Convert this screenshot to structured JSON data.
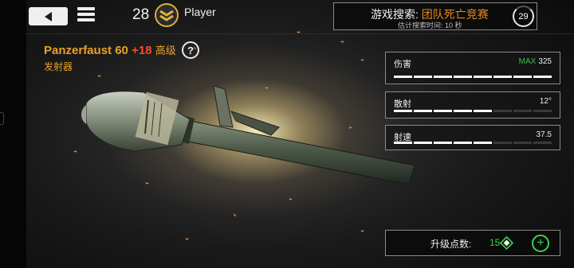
{
  "header": {
    "level": "28",
    "player_name": "Player"
  },
  "matchmaking": {
    "label_prefix": "游戏搜索: ",
    "mode": "团队死亡竞赛",
    "estimate": "估计搜索时间:  10 秒",
    "countdown": "29"
  },
  "weapon": {
    "name": "Panzerfaust 60",
    "bonus": "+18",
    "tier": "高级",
    "help": "?",
    "type": "发射器"
  },
  "stats": [
    {
      "label": "伤害",
      "max_label": "MAX",
      "value": "325",
      "segments_filled": 8,
      "segments_total": 8
    },
    {
      "label": "散射",
      "max_label": "",
      "value": "12°",
      "segments_filled": 5,
      "segments_total": 8
    },
    {
      "label": "射速",
      "max_label": "",
      "value": "37.5",
      "segments_filled": 5,
      "segments_total": 8
    }
  ],
  "upgrade": {
    "label": "升级点数:",
    "points": "15",
    "add": "+"
  },
  "colors": {
    "accent_orange": "#e8a12a",
    "bonus_red": "#ff4a2a",
    "positive_green": "#3bd14e",
    "panel_border": "#8a8a8a"
  },
  "icons": {
    "back": "back-arrow-icon",
    "menu": "hamburger-menu-icon",
    "rank": "sergeant-chevron-icon",
    "timer": "countdown-ring-icon",
    "points": "diamond-icon",
    "add": "plus-icon"
  }
}
